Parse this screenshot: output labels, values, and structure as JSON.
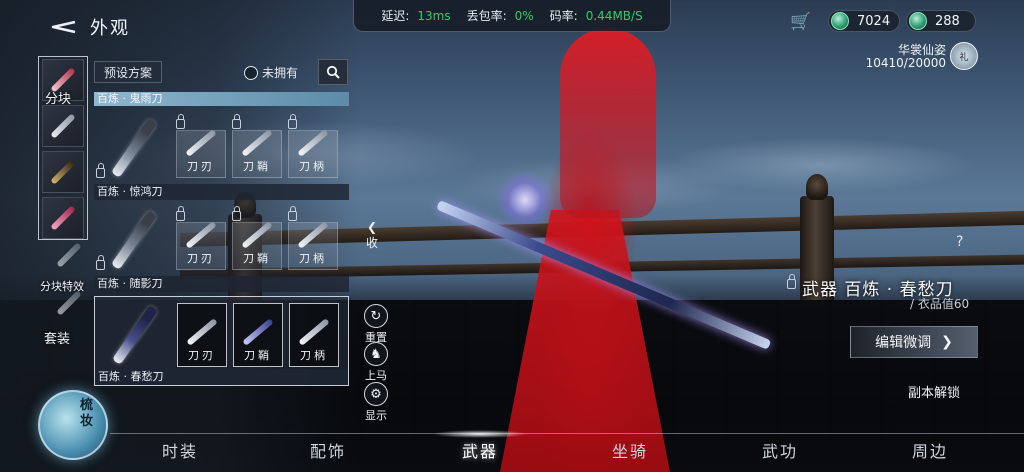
{
  "header": {
    "title": "外观"
  },
  "categories": [
    {
      "label": "分块"
    },
    {
      "label": "分块特效"
    },
    {
      "label": "套装"
    }
  ],
  "toolbar": {
    "preset_label": "预设方案",
    "filter_label": "未拥有"
  },
  "sets": [
    {
      "name": "百炼 · 鬼雨刀"
    },
    {
      "name": "百炼 · 惊鸿刀",
      "parts": [
        "刀刃",
        "刀鞘",
        "刀柄"
      ]
    },
    {
      "name": "百炼 · 随影刀",
      "parts": [
        "刀刃",
        "刀鞘",
        "刀柄"
      ]
    },
    {
      "name": "百炼 · 春愁刀",
      "parts": [
        "刀刃",
        "刀鞘",
        "刀柄"
      ]
    }
  ],
  "side_tools": {
    "reset": "重置",
    "mount": "上马",
    "display": "显示",
    "collapse": "收"
  },
  "network": {
    "latency_label": "延迟:",
    "latency_value": "13ms",
    "loss_label": "丢包率:",
    "loss_value": "0%",
    "rate_label": "码率:",
    "rate_value": "0.44MB/S"
  },
  "currency": {
    "coins_1": "7024",
    "coins_2": "288"
  },
  "outfit": {
    "title": "华裳仙姿",
    "score": "10410/20000",
    "badge": "礼"
  },
  "weapon_info": {
    "name": "武器 百炼 · 春愁刀",
    "value": "/ 衣品值60",
    "edit_label": "编辑微调",
    "unlock_label": "副本解锁",
    "help": "?"
  },
  "dress_button": {
    "label": "梳妆"
  },
  "tabs": [
    {
      "label": "时装"
    },
    {
      "label": "配饰"
    },
    {
      "label": "武器"
    },
    {
      "label": "坐骑"
    },
    {
      "label": "武功"
    },
    {
      "label": "周边"
    }
  ],
  "colors": {
    "accent_green": "#23d46a",
    "dress_red": "#c8161b"
  }
}
